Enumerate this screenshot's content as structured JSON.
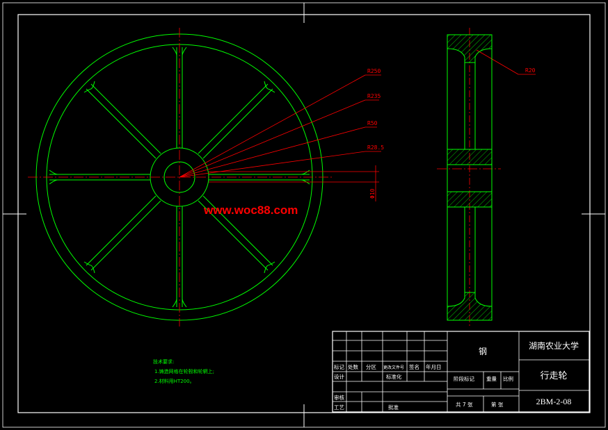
{
  "colors": {
    "background": "#000000",
    "frame": "#ffffff",
    "geometry": "#00ff00",
    "centerline": "#ff0000",
    "dimension": "#ff0000",
    "hatch": "#00ff00",
    "watermark": "#ff0000",
    "notes": "#00ff00"
  },
  "dimensions": {
    "r250": "R250",
    "r235": "R235",
    "r50": "R50",
    "r28": "R28.5",
    "d10": "Φ10",
    "r20": "R20"
  },
  "watermark": "www.woc88.com",
  "notes": {
    "title": "技术要求:",
    "line1": "1.铸造网格在轮毂和轮辋上;",
    "line2": "2.材料用HT200。"
  },
  "title_block": {
    "material": "钢",
    "university": "湖南农业大学",
    "part_name": "行走轮",
    "drawing_no": "2BM-2-08",
    "row_headers": [
      "标记",
      "处数",
      "分区",
      "更改文件号",
      "签名",
      "年月日"
    ],
    "design": "设计",
    "standardization": "标准化",
    "stage_mark": "阶段标记",
    "weight": "重量",
    "scale": "比例",
    "review": "审核",
    "process": "工艺",
    "approve": "批准",
    "sheets_total": "共 7 张",
    "sheet_no": "第  张"
  }
}
